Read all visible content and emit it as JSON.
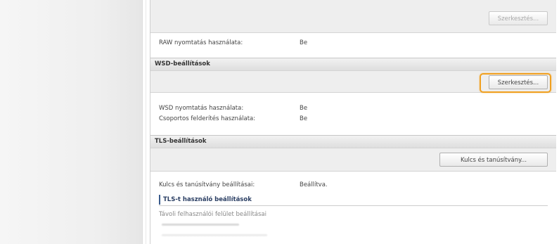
{
  "raw_section": {
    "edit_button": "Szerkesztés...",
    "rows": [
      {
        "label": "RAW nyomtatás használata:",
        "value": "Be"
      }
    ]
  },
  "wsd_section": {
    "title": "WSD-beállítások",
    "edit_button": "Szerkesztés...",
    "rows": [
      {
        "label": "WSD nyomtatás használata:",
        "value": "Be"
      },
      {
        "label": "Csoportos felderítés használata:",
        "value": "Be"
      }
    ]
  },
  "tls_section": {
    "title": "TLS-beállítások",
    "key_button": "Kulcs és tanúsítvány...",
    "rows": [
      {
        "label": "Kulcs és tanúsítvány beállításai:",
        "value": "Beállítva."
      }
    ],
    "subsection_title": "TLS-t használó beállítások",
    "subsection_first_item": "Távoli felhasználói felület beállításai"
  },
  "colors": {
    "highlight": "#f0a020",
    "section_header_bg": "#e4e4e4",
    "button_bar_bg": "#eeeeee"
  }
}
